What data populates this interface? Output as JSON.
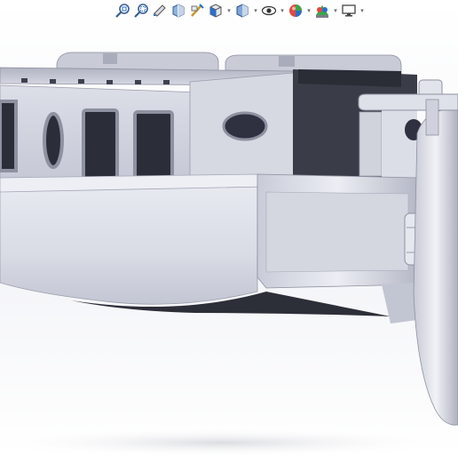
{
  "app": {
    "name": "3D CAD viewport"
  },
  "toolbar": {
    "items": [
      {
        "icon": "zoom-to-fit-icon",
        "has_dropdown": false
      },
      {
        "icon": "zoom-to-area-icon",
        "has_dropdown": false
      },
      {
        "icon": "previous-view-icon",
        "has_dropdown": false
      },
      {
        "icon": "section-view-icon",
        "has_dropdown": false
      },
      {
        "icon": "dynamic-annotation-views-icon",
        "has_dropdown": false
      },
      {
        "icon": "view-orientation-icon",
        "has_dropdown": true
      },
      {
        "icon": "display-style-icon",
        "has_dropdown": true
      },
      {
        "icon": "hide-show-items-icon",
        "has_dropdown": true
      },
      {
        "icon": "edit-appearance-icon",
        "has_dropdown": true
      },
      {
        "icon": "apply-scene-icon",
        "has_dropdown": true
      },
      {
        "icon": "view-settings-icon",
        "has_dropdown": true
      }
    ]
  },
  "colors": {
    "accent_blue": "#2a6fc9",
    "model_light": "#e3e5ee",
    "model_mid": "#b8bbc9",
    "model_dark": "#3a3c48"
  },
  "model": {
    "subject": "boat-hull-with-cabin",
    "shading": "shaded-with-edges"
  }
}
